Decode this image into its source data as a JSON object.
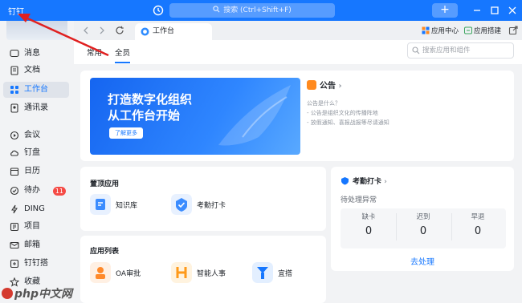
{
  "window": {
    "brand": "钉钉",
    "search_placeholder": "搜索 (Ctrl+Shift+F)",
    "add_label": "+"
  },
  "sidebar": {
    "items": [
      {
        "label": "消息",
        "icon": "message-icon"
      },
      {
        "label": "文档",
        "icon": "doc-icon"
      },
      {
        "label": "工作台",
        "icon": "grid-icon"
      },
      {
        "label": "通讯录",
        "icon": "contacts-icon"
      },
      {
        "label": "会议",
        "icon": "video-icon"
      },
      {
        "label": "钉盘",
        "icon": "cloud-icon"
      },
      {
        "label": "日历",
        "icon": "calendar-icon"
      },
      {
        "label": "待办",
        "icon": "todo-icon",
        "badge": "11"
      },
      {
        "label": "DING",
        "icon": "ding-icon"
      },
      {
        "label": "项目",
        "icon": "project-icon"
      },
      {
        "label": "邮箱",
        "icon": "mail-icon"
      },
      {
        "label": "钉钉搭",
        "icon": "builder-icon"
      },
      {
        "label": "收藏",
        "icon": "star-icon"
      }
    ]
  },
  "tabstrip": {
    "active_tab": "工作台",
    "tools": [
      "应用中心",
      "应用搭建"
    ]
  },
  "content": {
    "subtabs": [
      "常用",
      "全员"
    ],
    "search_placeholder": "搜索应用和组件",
    "banner": {
      "line1": "打造数字化组织",
      "line2": "从工作台开始",
      "button": "了解更多"
    },
    "notice": {
      "title": "公告",
      "lines": [
        "公告是什么？",
        "- 公告是组织文化的传播阵地",
        "- 放假通知、喜报战报等尽请通知"
      ]
    },
    "pinned": {
      "title": "置顶应用",
      "apps": [
        {
          "label": "知识库",
          "color": "#3b8cff"
        },
        {
          "label": "考勤打卡",
          "color": "#3b8cff"
        }
      ]
    },
    "applist": {
      "title": "应用列表",
      "apps": [
        {
          "label": "OA审批",
          "color": "#ff8a2b"
        },
        {
          "label": "智能人事",
          "color": "#ff9a1a"
        },
        {
          "label": "宜搭",
          "color": "#1677ff"
        }
      ]
    },
    "attendance": {
      "title": "考勤打卡",
      "subtitle": "待处理异常",
      "stats": [
        {
          "label": "缺卡",
          "value": "0"
        },
        {
          "label": "迟到",
          "value": "0"
        },
        {
          "label": "早退",
          "value": "0"
        }
      ],
      "action": "去处理"
    }
  },
  "watermark": "php中文网",
  "colors": {
    "primary": "#1677ff",
    "annotation": "#e02020"
  }
}
